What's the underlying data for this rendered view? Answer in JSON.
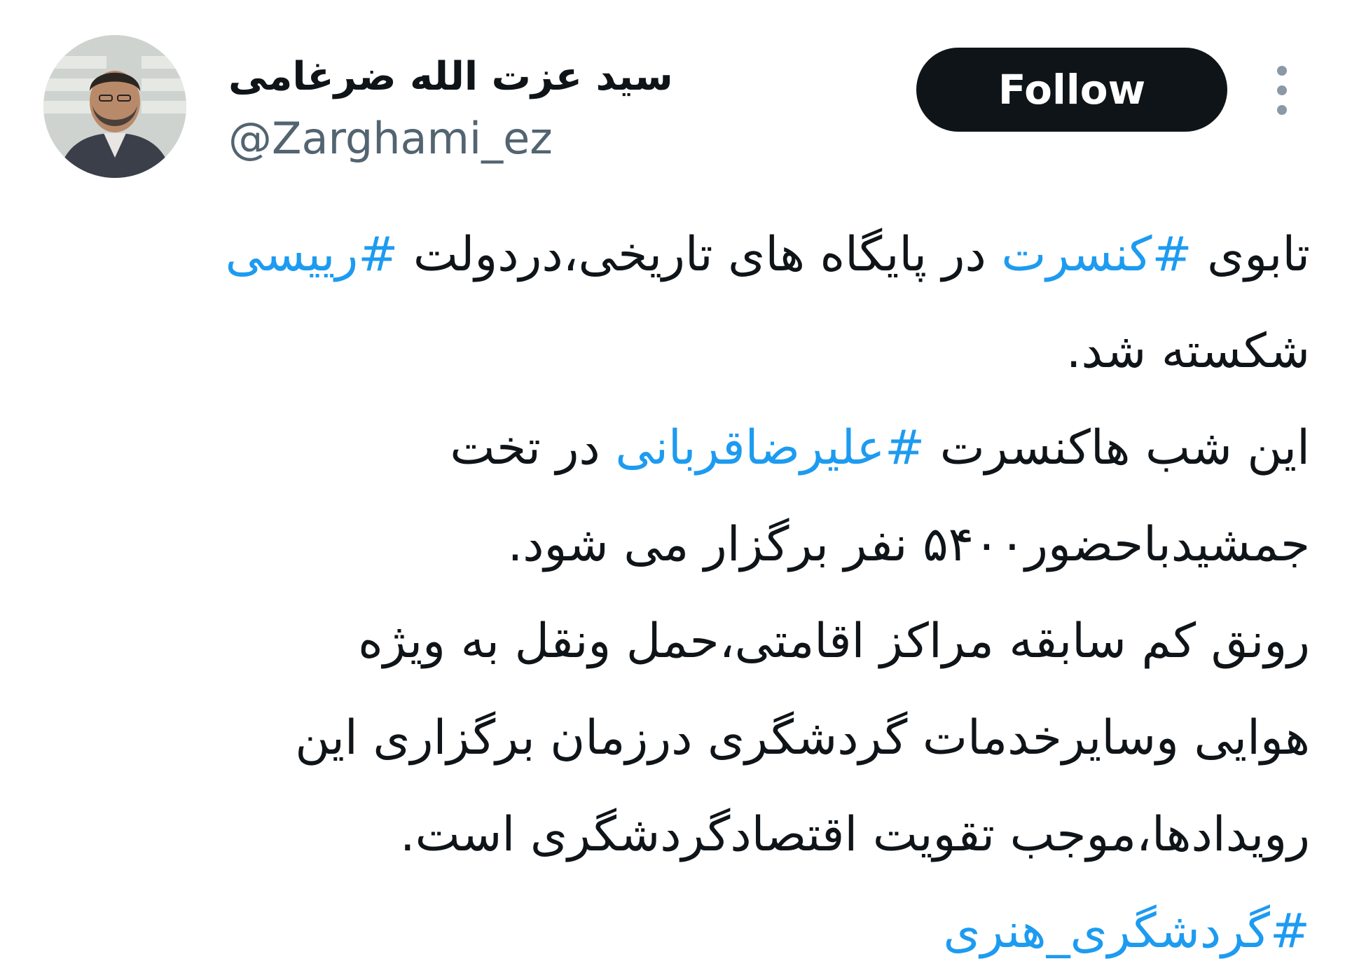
{
  "author": {
    "display_name": "سید عزت الله ضرغامی",
    "handle": "@Zarghami_ez",
    "avatar_icon": "person-photo"
  },
  "actions": {
    "follow_label": "Follow",
    "more_icon": "more-vertical-icon"
  },
  "colors": {
    "hashtag": "#1d9bf0",
    "button_bg": "#0f1419",
    "secondary_text": "#536471"
  },
  "tweet": {
    "line1": {
      "t1": "تابوی ",
      "h1": "#کنسرت",
      "t2": " در پایگاه های تاریخی،دردولت ",
      "h2": "#رییسی"
    },
    "line2": "شکسته شد.",
    "line3": {
      "t1": "این شب هاکنسرت ",
      "h1": "#علیرضاقربانی",
      "t2": " در تخت"
    },
    "line4": "جمشیدباحضور۵۴۰۰ نفر برگزار می شود.",
    "line5": "رونق کم سابقه مراکز اقامتی،حمل ونقل به ویژه",
    "line6": "هوایی وسایرخدمات گردشگری درزمان برگزاری این",
    "line7": "رویدادها،موجب تقویت اقتصادگردشگری است.",
    "line8": "#گردشگری_هنری"
  }
}
